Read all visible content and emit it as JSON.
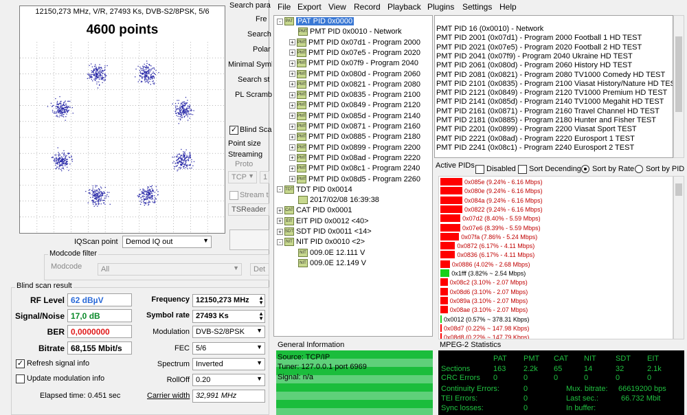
{
  "iq": {
    "params": "12150,273 MHz, V/R, 27493 Ks, DVB-S2/8PSK, 5/6",
    "points": "4600 points",
    "scan_point_label": "IQScan point",
    "scan_point_value": "Demod IQ out"
  },
  "settings": {
    "search_params": "Search para",
    "freq": "Fre",
    "search": "Search",
    "polar": "Polar",
    "minimal_symbol": "Minimal Symbo",
    "search_step": "Search st",
    "pl_scramble": "PL Scramb",
    "blind_scan": "Blind Sca",
    "point_size": "Point size",
    "streaming": "Streaming",
    "proto": "Proto",
    "tcp": "TCP",
    "tcp_num": "1",
    "stream": "Stream t",
    "tsreader": "TSReader",
    "det": "Det"
  },
  "modcode": {
    "group": "Modcode filter",
    "label": "Modcode",
    "value": "All"
  },
  "result": {
    "group": "Blind scan result",
    "rf_level_label": "RF Level",
    "rf_level": "62 dBµV",
    "snr_label": "Signal/Noise",
    "snr": "17,0 dB",
    "ber_label": "BER",
    "ber": "0,0000000",
    "bitrate_label": "Bitrate",
    "bitrate": "68,155 Mbit/s",
    "frequency_label": "Frequency",
    "frequency": "12150,273 MHz",
    "symbol_rate_label": "Symbol rate",
    "symbol_rate": "27493 Ks",
    "modulation_label": "Modulation",
    "modulation": "DVB-S2/8PSK",
    "fec_label": "FEC",
    "fec": "5/6",
    "spectrum_label": "Spectrum",
    "spectrum": "Inverted",
    "rolloff_label": "RollOff",
    "rolloff": "0.20",
    "carrier_label": "Carrier width",
    "carrier": "32,991 MHz",
    "refresh": "Refresh signal info",
    "refresh_check": "✓",
    "update": "Update modulation info",
    "elapsed": "Elapsed time: 0.451 sec"
  },
  "menu": [
    "File",
    "Export",
    "View",
    "Record",
    "Playback",
    "Plugins",
    "Settings",
    "Help"
  ],
  "tree": {
    "pat": "PAT PID 0x0000",
    "pmts": [
      "PMT PID 0x0010 - Network",
      "PMT PID 0x07d1 - Program 2000",
      "PMT PID 0x07e5 - Program 2020",
      "PMT PID 0x07f9 - Program 2040",
      "PMT PID 0x080d - Program 2060",
      "PMT PID 0x0821 - Program 2080",
      "PMT PID 0x0835 - Program 2100",
      "PMT PID 0x0849 - Program 2120",
      "PMT PID 0x085d - Program 2140",
      "PMT PID 0x0871 - Program 2160",
      "PMT PID 0x0885 - Program 2180",
      "PMT PID 0x0899 - Program 2200",
      "PMT PID 0x08ad - Program 2220",
      "PMT PID 0x08c1 - Program 2240",
      "PMT PID 0x08d5 - Program 2260"
    ],
    "tdt": "TDT PID 0x0014",
    "tdt_time": "2017/02/08 16:39:38",
    "cat": "CAT PID 0x0001",
    "eit": "EIT PID 0x0012 <40>",
    "sdt": "SDT PID 0x0011 <14>",
    "nit": "NIT PID 0x0010 <2>",
    "nit_items": [
      "009.0E 12.111 V",
      "009.0E 12.149 V"
    ],
    "icons": {
      "pat": "PAT",
      "pmt": "PMT",
      "tdt": "TDT",
      "cat": "CAT",
      "eit": "EIT",
      "sdt": "SDT",
      "nit": "NIT"
    }
  },
  "program_list": [
    "PMT PID 16 (0x0010) - Network",
    "PMT PID 2001 (0x07d1) - Program 2000 Football 1 HD TEST",
    "PMT PID 2021 (0x07e5) - Program 2020 Football 2 HD TEST",
    "PMT PID 2041 (0x07f9) - Program 2040 Ukraine HD TEST",
    "PMT PID 2061 (0x080d) - Program 2060 History HD TEST",
    "PMT PID 2081 (0x0821) - Program 2080 TV1000 Comedy HD TEST",
    "PMT PID 2101 (0x0835) - Program 2100 Viasat History/Nature HD TEST",
    "PMT PID 2121 (0x0849) - Program 2120 TV1000 Premium HD TEST",
    "PMT PID 2141 (0x085d) - Program 2140 TV1000 Megahit HD TEST",
    "PMT PID 2161 (0x0871) - Program 2160 Travel Channel HD TEST",
    "PMT PID 2181 (0x0885) - Program 2180 Hunter and Fisher TEST",
    "PMT PID 2201 (0x0899) - Program 2200 Viasat Sport TEST",
    "PMT PID 2221 (0x08ad) - Program 2220 Eurosport 1 TEST",
    "PMT PID 2241 (0x08c1) - Program 2240 Eurosport 2 TEST"
  ],
  "active_pids": {
    "title": "Active PIDs",
    "disabled": "Disabled",
    "sort_desc": "Sort Decending",
    "sort_rate": "Sort by Rate",
    "sort_pid": "Sort by PID",
    "rows": [
      {
        "label": "0x085e (9.24% - 6.16 Mbps)",
        "pct": 9.24,
        "color": "#ff0000"
      },
      {
        "label": "0x080e (9.24% - 6.16 Mbps)",
        "pct": 9.24,
        "color": "#ff0000"
      },
      {
        "label": "0x084a (9.24% - 6.16 Mbps)",
        "pct": 9.24,
        "color": "#ff0000"
      },
      {
        "label": "0x0822 (9.24% - 6.16 Mbps)",
        "pct": 9.24,
        "color": "#ff0000"
      },
      {
        "label": "0x07d2 (8.40% - 5.59 Mbps)",
        "pct": 8.4,
        "color": "#ff0000"
      },
      {
        "label": "0x07e6 (8.39% - 5.59 Mbps)",
        "pct": 8.39,
        "color": "#ff0000"
      },
      {
        "label": "0x07fa (7.86% - 5.24 Mbps)",
        "pct": 7.86,
        "color": "#ff0000"
      },
      {
        "label": "0x0872 (6.17% - 4.11 Mbps)",
        "pct": 6.17,
        "color": "#ff0000"
      },
      {
        "label": "0x0836 (6.17% - 4.11 Mbps)",
        "pct": 6.17,
        "color": "#ff0000"
      },
      {
        "label": "0x0886 (4.02% - 2.68 Mbps)",
        "pct": 4.02,
        "color": "#ff0000"
      },
      {
        "label": "0x1fff (3.82% ~ 2.54 Mbps)",
        "pct": 3.82,
        "color": "#19d019"
      },
      {
        "label": "0x08c2 (3.10% - 2.07 Mbps)",
        "pct": 3.1,
        "color": "#ff0000"
      },
      {
        "label": "0x08d6 (3.10% - 2.07 Mbps)",
        "pct": 3.1,
        "color": "#ff0000"
      },
      {
        "label": "0x089a (3.10% - 2.07 Mbps)",
        "pct": 3.1,
        "color": "#ff0000"
      },
      {
        "label": "0x08ae (3.10% - 2.07 Mbps)",
        "pct": 3.1,
        "color": "#ff0000"
      },
      {
        "label": "0x0012 (0.57% ~ 378.31 Kbps)",
        "pct": 0.57,
        "color": "#19d019"
      },
      {
        "label": "0x08d7 (0.22% ~ 147.98 Kbps)",
        "pct": 0.22,
        "color": "#ff0000"
      },
      {
        "label": "0x08d8 (0.22% ~ 147.79 Kbps)",
        "pct": 0.22,
        "color": "#ff0000"
      }
    ]
  },
  "general": {
    "title": "General Information",
    "source": "Source: TCP/IP",
    "tuner": "Tuner: 127.0.0.1 port 6969",
    "signal": "Signal: n/a"
  },
  "mpeg": {
    "title": "MPEG-2 Statistics",
    "headers": [
      "PAT",
      "PMT",
      "CAT",
      "NIT",
      "SDT",
      "EIT"
    ],
    "sections_label": "Sections",
    "sections": [
      "163",
      "2.2k",
      "65",
      "14",
      "32",
      "2.1k"
    ],
    "crc_label": "CRC Errors",
    "crc": [
      "0",
      "0",
      "0",
      "0",
      "0",
      "0"
    ],
    "cont_label": "Continuity Errors:",
    "cont": "0",
    "tei_label": "TEI Errors:",
    "tei": "0",
    "sync_label": "Sync losses:",
    "sync": "0",
    "mux_label": "Mux. bitrate:",
    "mux": "66619200 bps",
    "last_label": "Last sec.:",
    "last": "66.732 Mbit",
    "buffer_label": "In buffer:"
  }
}
